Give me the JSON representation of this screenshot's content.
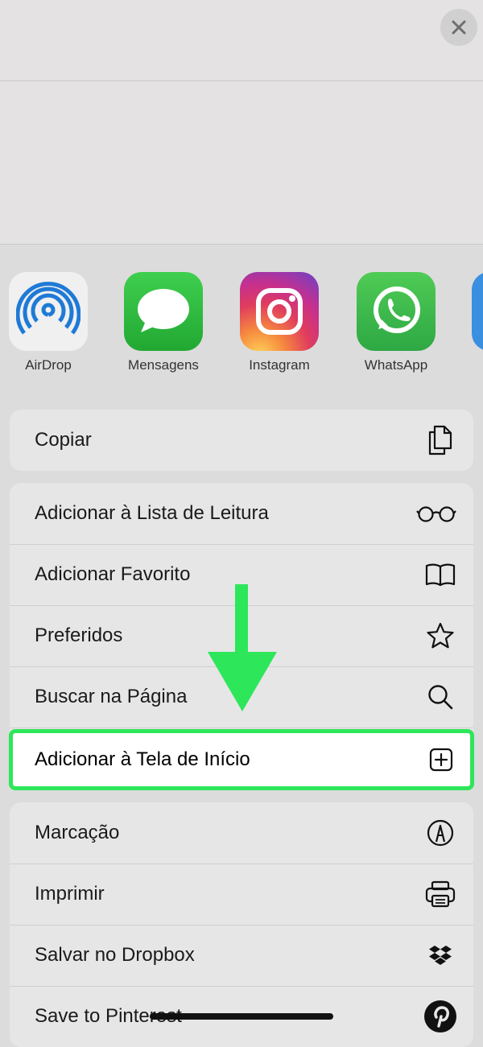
{
  "header": {
    "close_icon": "xmark-icon"
  },
  "apps": [
    {
      "label": "AirDrop",
      "icon": "airdrop-icon"
    },
    {
      "label": "Mensagens",
      "icon": "messages-icon"
    },
    {
      "label": "Instagram",
      "icon": "instagram-icon"
    },
    {
      "label": "WhatsApp",
      "icon": "whatsapp-icon"
    }
  ],
  "actions": {
    "copy": {
      "label": "Copiar",
      "icon": "copy-icon"
    },
    "reading_list": {
      "label": "Adicionar à Lista de Leitura",
      "icon": "glasses-icon"
    },
    "add_bookmark": {
      "label": "Adicionar Favorito",
      "icon": "book-icon"
    },
    "favorites": {
      "label": "Preferidos",
      "icon": "star-icon"
    },
    "find_on_page": {
      "label": "Buscar na Página",
      "icon": "magnifier-icon"
    },
    "add_to_home": {
      "label": "Adicionar à Tela de Início",
      "icon": "plus-square-icon"
    },
    "markup": {
      "label": "Marcação",
      "icon": "markup-icon"
    },
    "print": {
      "label": "Imprimir",
      "icon": "printer-icon"
    },
    "dropbox": {
      "label": "Salvar no Dropbox",
      "icon": "dropbox-icon"
    },
    "pinterest": {
      "label": "Save to Pinterest",
      "icon": "pinterest-icon"
    }
  },
  "colors": {
    "highlight_border": "#2ee65a",
    "arrow": "#2ee65a"
  }
}
